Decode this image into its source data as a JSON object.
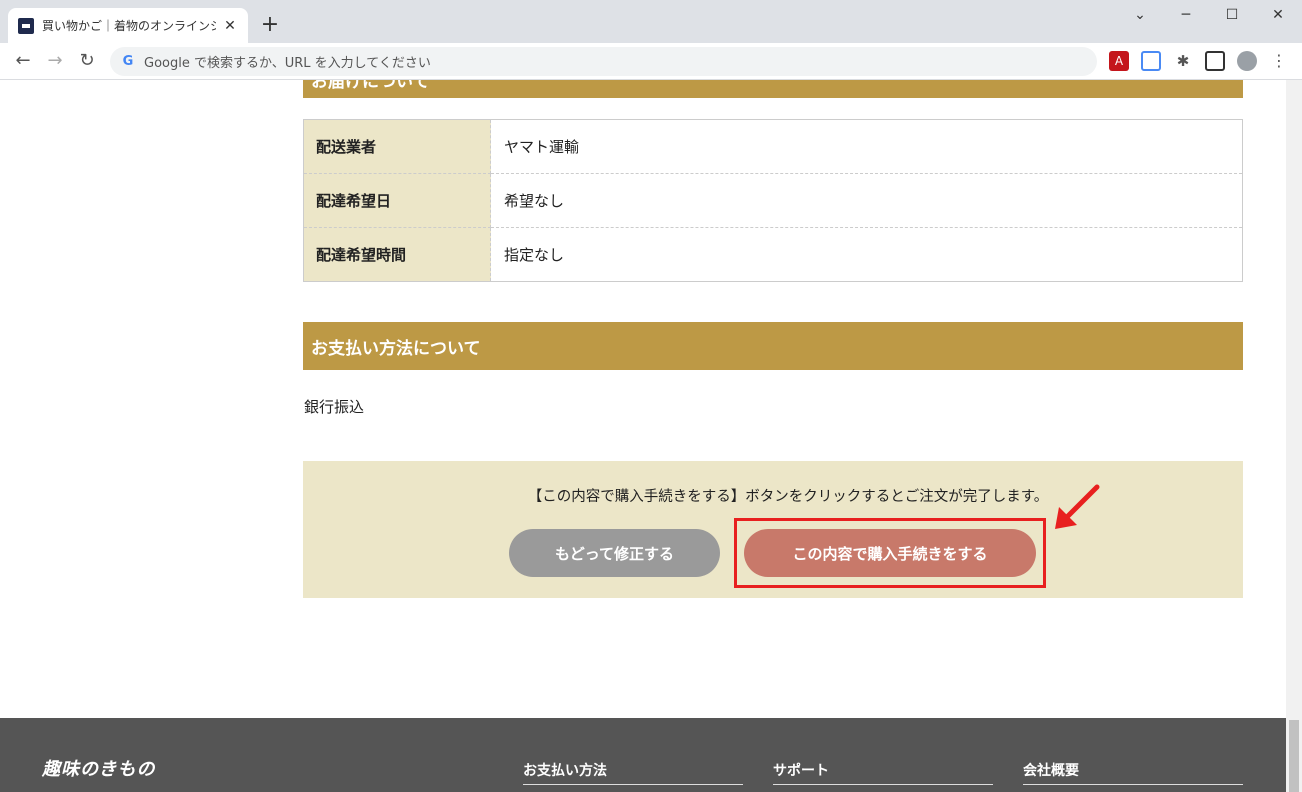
{
  "browser": {
    "tab_title": "買い物かご｜着物のオンラインショップ",
    "tab_close": "✕",
    "new_tab": "+",
    "omnibox_placeholder": "Google で検索するか、URL を入力してください",
    "google_letter": "G",
    "window_controls": [
      "⌄",
      "─",
      "☐",
      "✕"
    ],
    "nav": {
      "back": "←",
      "forward": "→",
      "reload": "↻"
    },
    "extensions": [
      "pdf-icon",
      "translate-icon",
      "puzzle-icon",
      "sidepanel-icon",
      "profile-icon",
      "menu-icon"
    ]
  },
  "page": {
    "delivery_section_title": "お届けについて",
    "delivery_rows": [
      {
        "label": "配送業者",
        "value": "ヤマト運輸"
      },
      {
        "label": "配達希望日",
        "value": "希望なし"
      },
      {
        "label": "配達希望時間",
        "value": "指定なし"
      }
    ],
    "payment_section_title": "お支払い方法について",
    "payment_method": "銀行振込",
    "notice": "【この内容で購入手続きをする】ボタンをクリックするとご注文が完了します。",
    "back_button": "もどって修正する",
    "buy_button": "この内容で購入手続きをする"
  },
  "footer": {
    "logo_text": "趣味のきもの",
    "columns": [
      "お支払い方法",
      "サポート",
      "会社概要"
    ]
  },
  "colors": {
    "section_header": "#bd9945",
    "table_label_bg": "#ece6c8",
    "back_button": "#9a9a9a",
    "buy_button": "#c8796a",
    "highlight": "#e8201f",
    "footer_bg": "#555555"
  }
}
